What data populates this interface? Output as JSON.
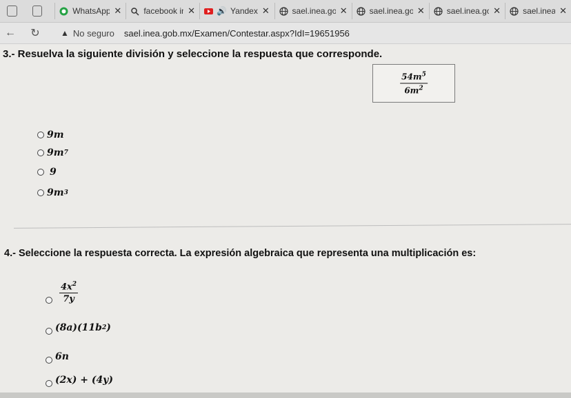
{
  "browser": {
    "tabs": [
      {
        "title": "WhatsApp",
        "icon": "whatsapp-icon"
      },
      {
        "title": "facebook in",
        "icon": "search-icon"
      },
      {
        "title": "Yandex",
        "icon": "video-icon"
      },
      {
        "title": "sael.inea.go",
        "icon": "globe-icon"
      },
      {
        "title": "sael.inea.go",
        "icon": "globe-icon"
      },
      {
        "title": "sael.inea.go",
        "icon": "globe-icon"
      },
      {
        "title": "sael.inea.go",
        "icon": "globe-icon"
      }
    ],
    "security": "No seguro",
    "url": "sael.inea.gob.mx/Examen/Contestar.aspx?IdI=19651956"
  },
  "question3": {
    "prompt": "3.- Resuelva la siguiente división y seleccione la respuesta que corresponde.",
    "fraction": {
      "numerator": "54m",
      "numerator_exp": "5",
      "denominator": "6m",
      "denominator_exp": "2"
    },
    "options": [
      {
        "base": "9m",
        "exp": ""
      },
      {
        "base": "9m",
        "exp": "7"
      },
      {
        "base": "9",
        "exp": ""
      },
      {
        "base": "9m",
        "exp": "3"
      }
    ]
  },
  "question4": {
    "prompt": "4.- Seleccione la respuesta correcta. La expresión algebraica que representa una multiplicación es:",
    "option1": {
      "numerator": "4x",
      "numerator_exp": "2",
      "denominator": "7y"
    },
    "option2": {
      "text": "(8a)(11b",
      "exp": "2",
      "suffix": ")"
    },
    "option3": {
      "text": "6n"
    },
    "option4": {
      "text": "(2x) + (4y)"
    }
  }
}
